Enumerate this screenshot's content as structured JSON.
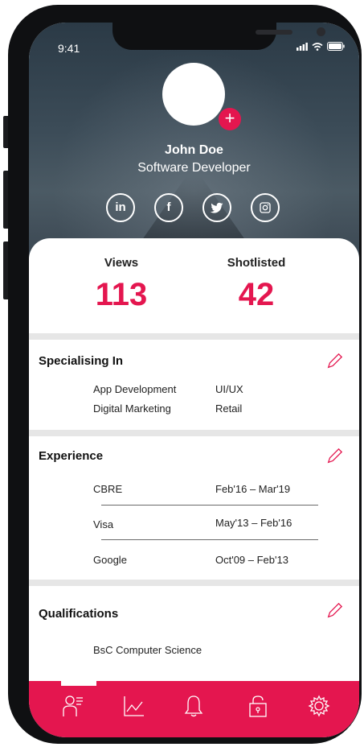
{
  "status_bar": {
    "time": "9:41",
    "icons": [
      "signal-icon",
      "wifi-icon",
      "battery-icon"
    ]
  },
  "profile": {
    "name": "John Doe",
    "role": "Software Developer",
    "avatar_add_label": "+",
    "socials": [
      {
        "icon": "linkedin-icon",
        "label": "in"
      },
      {
        "icon": "facebook-icon",
        "label": "f"
      },
      {
        "icon": "twitter-icon",
        "label": ""
      },
      {
        "icon": "instagram-icon",
        "label": ""
      }
    ]
  },
  "stats": {
    "views_label": "Views",
    "views_value": "113",
    "shortlisted_label": "Shotlisted",
    "shortlisted_value": "42"
  },
  "specialising": {
    "title": "Specialising In",
    "items": [
      [
        "App Development",
        "UI/UX"
      ],
      [
        "Digital Marketing",
        "Retail"
      ]
    ]
  },
  "experience": {
    "title": "Experience",
    "rows": [
      {
        "company": "CBRE",
        "period": "Feb'16 – Mar'19"
      },
      {
        "company": "Visa",
        "period": "May'13 – Feb'16"
      },
      {
        "company": "Google",
        "period": "Oct'09 – Feb'13"
      }
    ]
  },
  "qualifications": {
    "title": "Qualifications",
    "items": [
      "BsC Computer Science"
    ]
  },
  "bottom_nav": {
    "items": [
      "profile-icon",
      "analytics-icon",
      "bell-icon",
      "lock-icon",
      "settings-icon"
    ]
  },
  "colors": {
    "accent": "#e4164f",
    "dark": "#0f1012"
  }
}
